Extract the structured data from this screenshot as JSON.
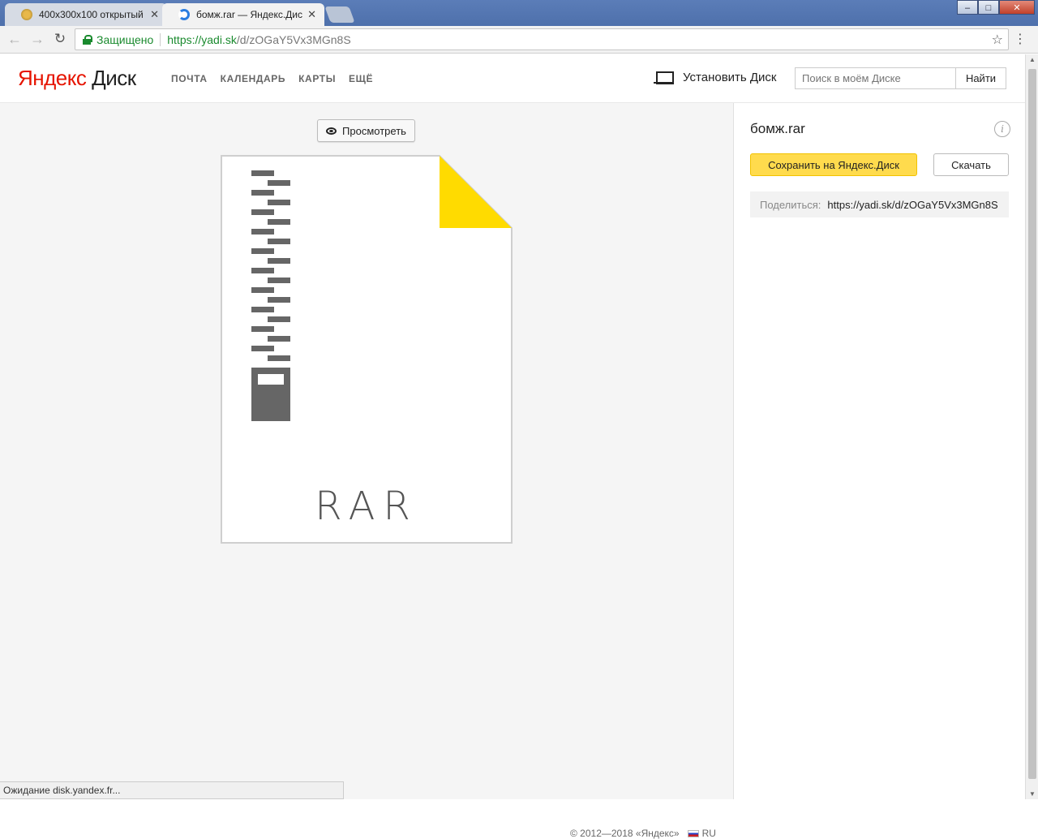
{
  "browser": {
    "tabs": [
      {
        "title": "400x300x100 открытый",
        "active": false
      },
      {
        "title": "бомж.rar — Яндекс.Диск",
        "active": true
      }
    ],
    "secure_label": "Защищено",
    "url_host": "https://yadi.sk",
    "url_path": "/d/zOGaY5Vx3MGn8S",
    "status_text": "Ожидание disk.yandex.fr..."
  },
  "header": {
    "logo_ya": "Яндекс",
    "logo_product": "Диск",
    "nav": [
      "ПОЧТА",
      "КАЛЕНДАРЬ",
      "КАРТЫ",
      "ЕЩЁ"
    ],
    "install_label": "Установить Диск",
    "search_placeholder": "Поиск в моём Диске",
    "search_button": "Найти"
  },
  "main": {
    "preview_button": "Просмотреть",
    "file_type": "RAR",
    "accent_color": "#ffdb00",
    "icon_color": "#666666"
  },
  "sidebar": {
    "file_name": "бомж.rar",
    "info_glyph": "i",
    "save_button": "Сохранить на Яндекс.Диск",
    "download_button": "Скачать",
    "share_label": "Поделиться:",
    "share_link": "https://yadi.sk/d/zOGaY5Vx3MGn8S"
  },
  "footer": {
    "copyright": "© 2012—2018 «Яндекс»",
    "language": "RU"
  }
}
